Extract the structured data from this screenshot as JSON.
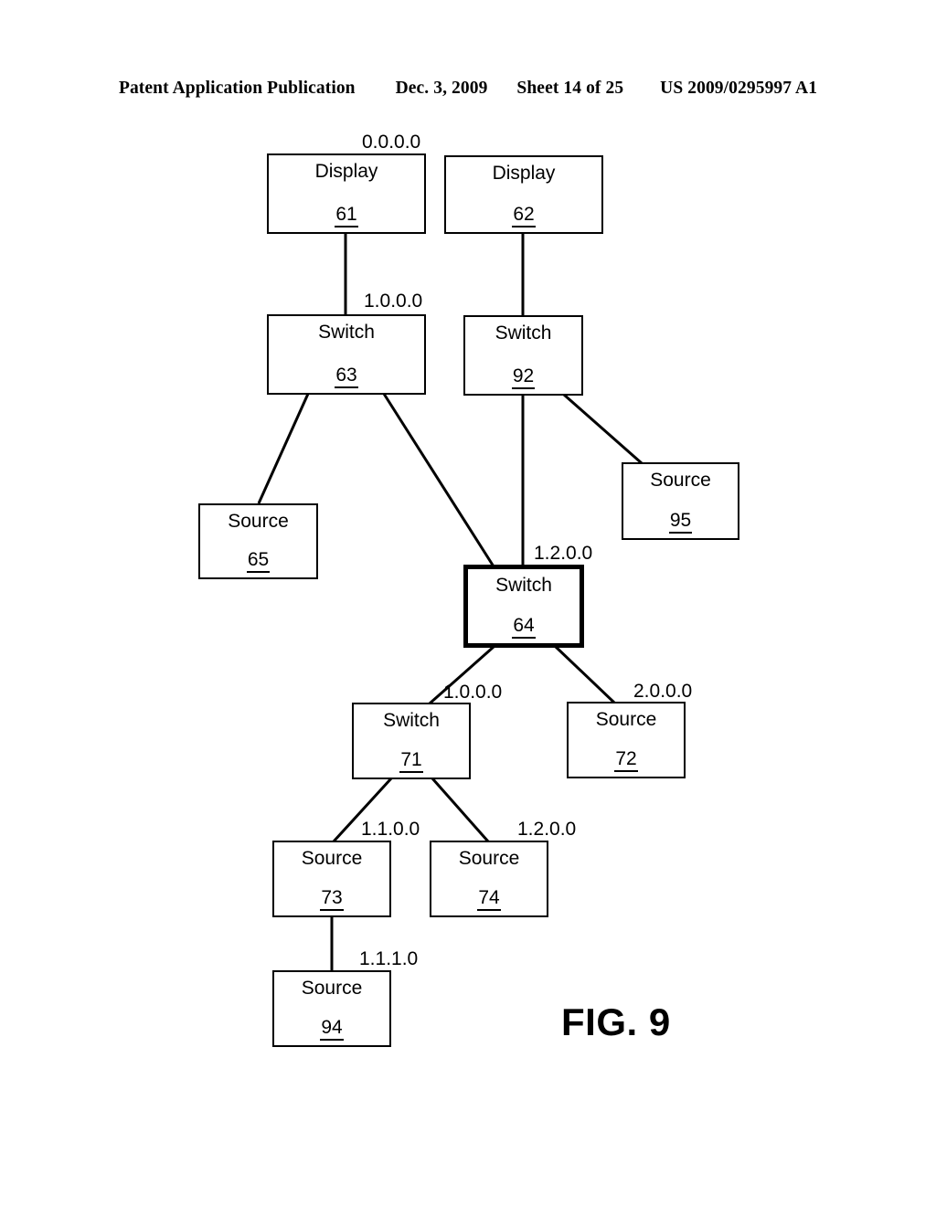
{
  "page_header": {
    "publication": "Patent Application Publication",
    "date": "Dec. 3, 2009",
    "sheet": "Sheet 14 of 25",
    "patent_number": "US 2009/0295997 A1"
  },
  "figure": {
    "caption": "FIG. 9"
  },
  "diagram": {
    "nodes": [
      {
        "id": "n61",
        "type": "Display",
        "number": "61",
        "highlighted": false
      },
      {
        "id": "n62",
        "type": "Display",
        "number": "62",
        "highlighted": false
      },
      {
        "id": "n63",
        "type": "Switch",
        "number": "63",
        "highlighted": false
      },
      {
        "id": "n92",
        "type": "Switch",
        "number": "92",
        "highlighted": false
      },
      {
        "id": "n65",
        "type": "Source",
        "number": "65",
        "highlighted": false
      },
      {
        "id": "n95",
        "type": "Source",
        "number": "95",
        "highlighted": false
      },
      {
        "id": "n64",
        "type": "Switch",
        "number": "64",
        "highlighted": true
      },
      {
        "id": "n71",
        "type": "Switch",
        "number": "71",
        "highlighted": false
      },
      {
        "id": "n72",
        "type": "Source",
        "number": "72",
        "highlighted": false
      },
      {
        "id": "n73",
        "type": "Source",
        "number": "73",
        "highlighted": false
      },
      {
        "id": "n74",
        "type": "Source",
        "number": "74",
        "highlighted": false
      },
      {
        "id": "n94",
        "type": "Source",
        "number": "94",
        "highlighted": false
      }
    ],
    "address_labels": [
      {
        "id": "a0",
        "text": "0.0.0.0",
        "for": "n61"
      },
      {
        "id": "a1",
        "text": "1.0.0.0",
        "for": "n63"
      },
      {
        "id": "a2",
        "text": "1.2.0.0",
        "for": "n64"
      },
      {
        "id": "a3",
        "text": "1.0.0.0",
        "for": "n71"
      },
      {
        "id": "a4",
        "text": "2.0.0.0",
        "for": "n72"
      },
      {
        "id": "a5",
        "text": "1.1.0.0",
        "for": "n73"
      },
      {
        "id": "a6",
        "text": "1.2.0.0",
        "for": "n74"
      },
      {
        "id": "a7",
        "text": "1.1.1.0",
        "for": "n94"
      }
    ],
    "connections": [
      {
        "from": "n61",
        "to": "n63"
      },
      {
        "from": "n62",
        "to": "n92"
      },
      {
        "from": "n63",
        "to": "n65"
      },
      {
        "from": "n63",
        "to": "n64"
      },
      {
        "from": "n92",
        "to": "n95"
      },
      {
        "from": "n92",
        "to": "n64"
      },
      {
        "from": "n64",
        "to": "n71"
      },
      {
        "from": "n64",
        "to": "n72"
      },
      {
        "from": "n71",
        "to": "n73"
      },
      {
        "from": "n71",
        "to": "n74"
      },
      {
        "from": "n73",
        "to": "n94"
      }
    ]
  },
  "colors": {
    "ink": "#000000",
    "paper": "#ffffff"
  }
}
